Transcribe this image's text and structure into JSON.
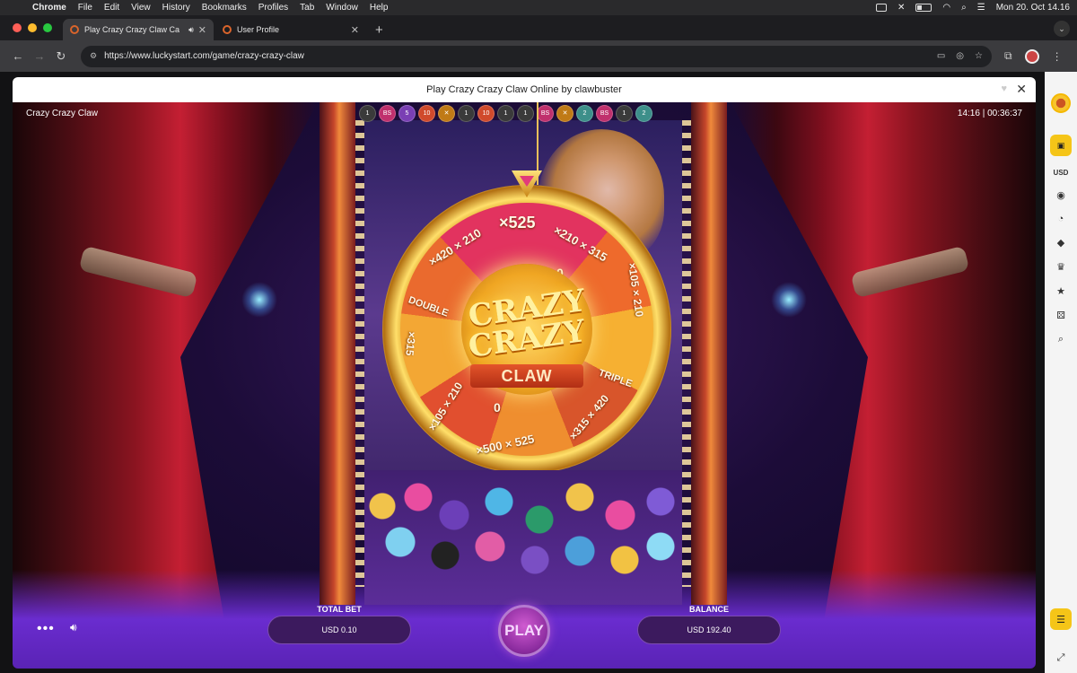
{
  "menubar": {
    "app": "Chrome",
    "items": [
      "File",
      "Edit",
      "View",
      "History",
      "Bookmarks",
      "Profiles",
      "Tab",
      "Window",
      "Help"
    ],
    "datetime": "Mon 20. Oct  14.16"
  },
  "tabs": [
    {
      "title": "Play Crazy Crazy Claw Ca"
    },
    {
      "title": "User Profile"
    }
  ],
  "toolbar": {
    "url": "https://www.luckystart.com/game/crazy-crazy-claw"
  },
  "modal": {
    "title": "Play Crazy Crazy Claw Online by clawbuster"
  },
  "game": {
    "name": "Crazy Crazy Claw",
    "clock": "14:16  |  00:36:37",
    "history_chips": [
      {
        "label": "1",
        "color": "#3a3a3a"
      },
      {
        "label": "BS",
        "color": "#c0306d"
      },
      {
        "label": "5",
        "color": "#7a3fb4"
      },
      {
        "label": "10",
        "color": "#d04a2c"
      },
      {
        "label": "✕",
        "color": "#c07a16"
      },
      {
        "label": "1",
        "color": "#3a3a3a"
      },
      {
        "label": "10",
        "color": "#d04a2c"
      },
      {
        "label": "1",
        "color": "#3a3a3a"
      },
      {
        "label": "1",
        "color": "#3a3a3a"
      },
      {
        "label": "BS",
        "color": "#c0306d"
      },
      {
        "label": "✕",
        "color": "#c07a16"
      },
      {
        "label": "2",
        "color": "#3d8f8a"
      },
      {
        "label": "BS",
        "color": "#c0306d"
      },
      {
        "label": "1",
        "color": "#3a3a3a"
      },
      {
        "label": "2",
        "color": "#3d8f8a"
      }
    ],
    "wheel": {
      "top_value": "×525",
      "ring_left": "×420 × 210",
      "ring_right": "×210 × 315",
      "label_double": "DOUBLE",
      "label_triple": "TRIPLE",
      "right_side": "×105 × 210",
      "left_side": "×315",
      "left_low": "×105 × 210",
      "bottom": "×500 × 525",
      "bottom_right": "×315 × 420",
      "zero": "0",
      "logo_line1": "CRAZY",
      "logo_line2": "CRAZY",
      "logo_ribbon": "CLAW"
    },
    "total_bet_label": "TOTAL BET",
    "total_bet_value": "USD 0.10",
    "play_label": "PLAY",
    "balance_label": "BALANCE",
    "balance_value": "USD 192.40"
  },
  "sidebar": {
    "currency": "USD"
  }
}
